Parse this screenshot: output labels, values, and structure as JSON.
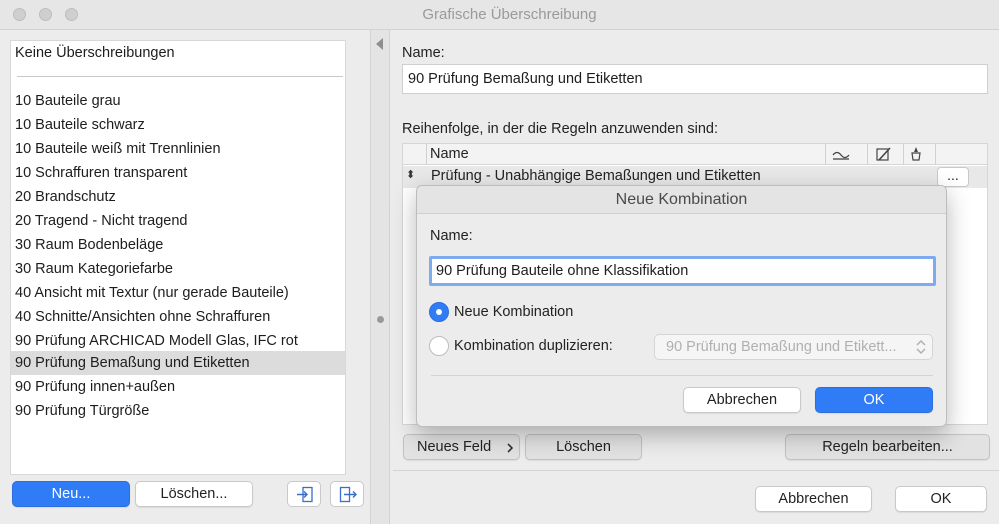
{
  "window": {
    "title": "Grafische Überschreibung"
  },
  "left_panel": {
    "top_item": "Keine Überschreibungen",
    "items": [
      "10 Bauteile grau",
      "10 Bauteile schwarz",
      "10 Bauteile weiß mit Trennlinien",
      "10 Schraffuren transparent",
      "20 Brandschutz",
      "20 Tragend - Nicht tragend",
      "30 Raum Bodenbeläge",
      "30 Raum Kategoriefarbe",
      "40 Ansicht mit Textur (nur gerade Bauteile)",
      "40 Schnitte/Ansichten ohne Schraffuren",
      "90 Prüfung ARCHICAD Modell Glas, IFC rot",
      "90 Prüfung Bemaßung und Etiketten",
      "90 Prüfung innen+außen",
      "90 Prüfung Türgröße"
    ],
    "selected_index": 11,
    "new_button": "Neu...",
    "delete_button": "Löschen...",
    "import_icon": "import-icon",
    "export_icon": "export-icon"
  },
  "right_panel": {
    "name_label": "Name:",
    "name_value": "90 Prüfung Bemaßung und Etiketten",
    "order_label": "Reihenfolge, in der die Regeln anzuwenden sind:",
    "table": {
      "header_name": "Name",
      "header_icons": [
        "fill-icon",
        "pen-icon",
        "brush-icon"
      ],
      "rows": [
        {
          "name": "Prüfung - Unabhängige Bemaßungen und Etiketten",
          "more": "..."
        }
      ]
    },
    "new_field_button": "Neues Feld",
    "delete_button": "Löschen",
    "edit_rules_button": "Regeln bearbeiten...",
    "cancel_button": "Abbrechen",
    "ok_button": "OK"
  },
  "modal": {
    "title": "Neue Kombination",
    "name_label": "Name:",
    "name_value": "90 Prüfung Bauteile ohne Klassifikation",
    "radio_new": "Neue Kombination",
    "radio_duplicate": "Kombination duplizieren:",
    "duplicate_select_value": "90 Prüfung Bemaßung und Etikett...",
    "cancel_button": "Abbrechen",
    "ok_button": "OK",
    "accent_color": "#2f7cf6"
  }
}
